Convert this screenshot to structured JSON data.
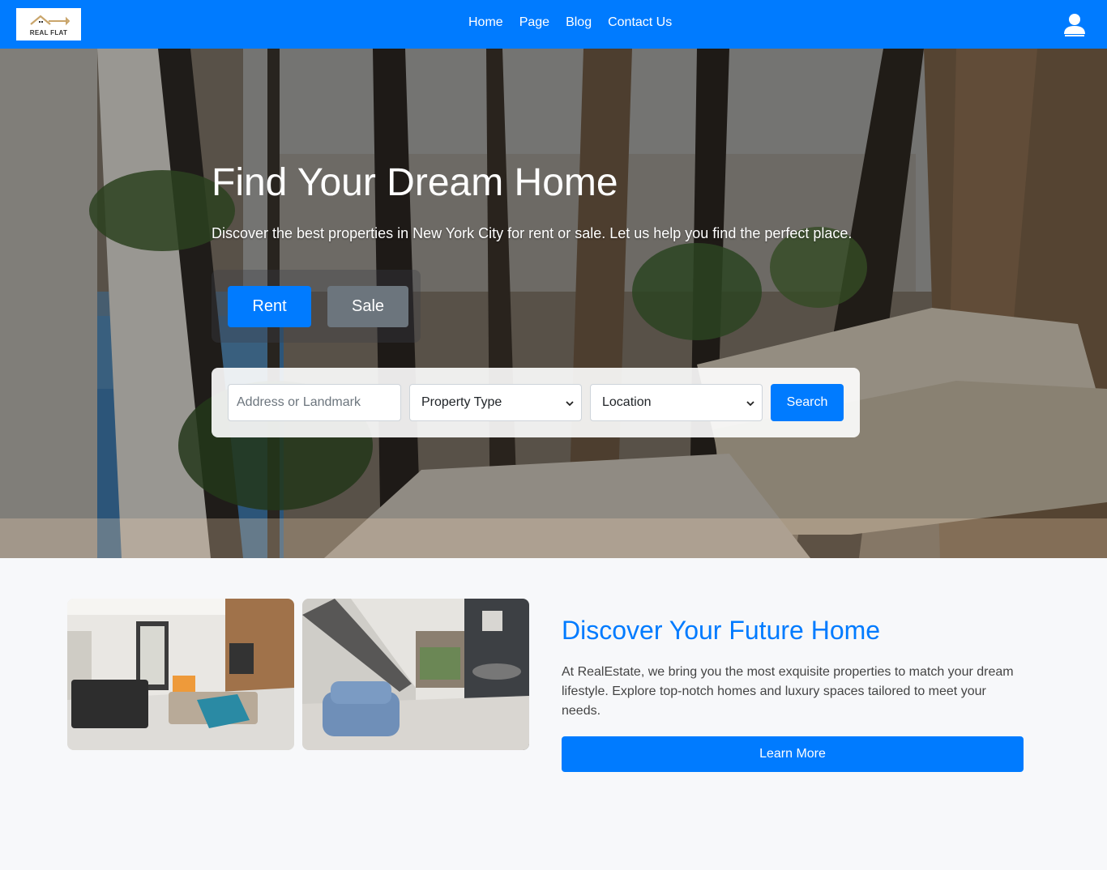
{
  "brand": {
    "logo_text": "REAL FLAT"
  },
  "nav": {
    "items": [
      "Home",
      "Page",
      "Blog",
      "Contact Us"
    ]
  },
  "hero": {
    "title": "Find Your Dream Home",
    "subtitle": "Discover the best properties in New York City for rent or sale. Let us help you find the perfect place.",
    "tabs": {
      "rent": "Rent",
      "sale": "Sale"
    },
    "search": {
      "address_placeholder": "Address or Landmark",
      "property_type": "Property Type",
      "location": "Location",
      "button": "Search"
    }
  },
  "feature": {
    "title": "Discover Your Future Home",
    "text": "At RealEstate, we bring you the most exquisite properties to match your dream lifestyle. Explore top-notch homes and luxury spaces tailored to meet your needs.",
    "button": "Learn More"
  },
  "icons": [
    "house-key-logo-icon",
    "user-icon",
    "chevron-down-icon"
  ],
  "colors": {
    "primary": "#007bff",
    "secondary": "#6c757d",
    "background": "#f7f8fa"
  }
}
